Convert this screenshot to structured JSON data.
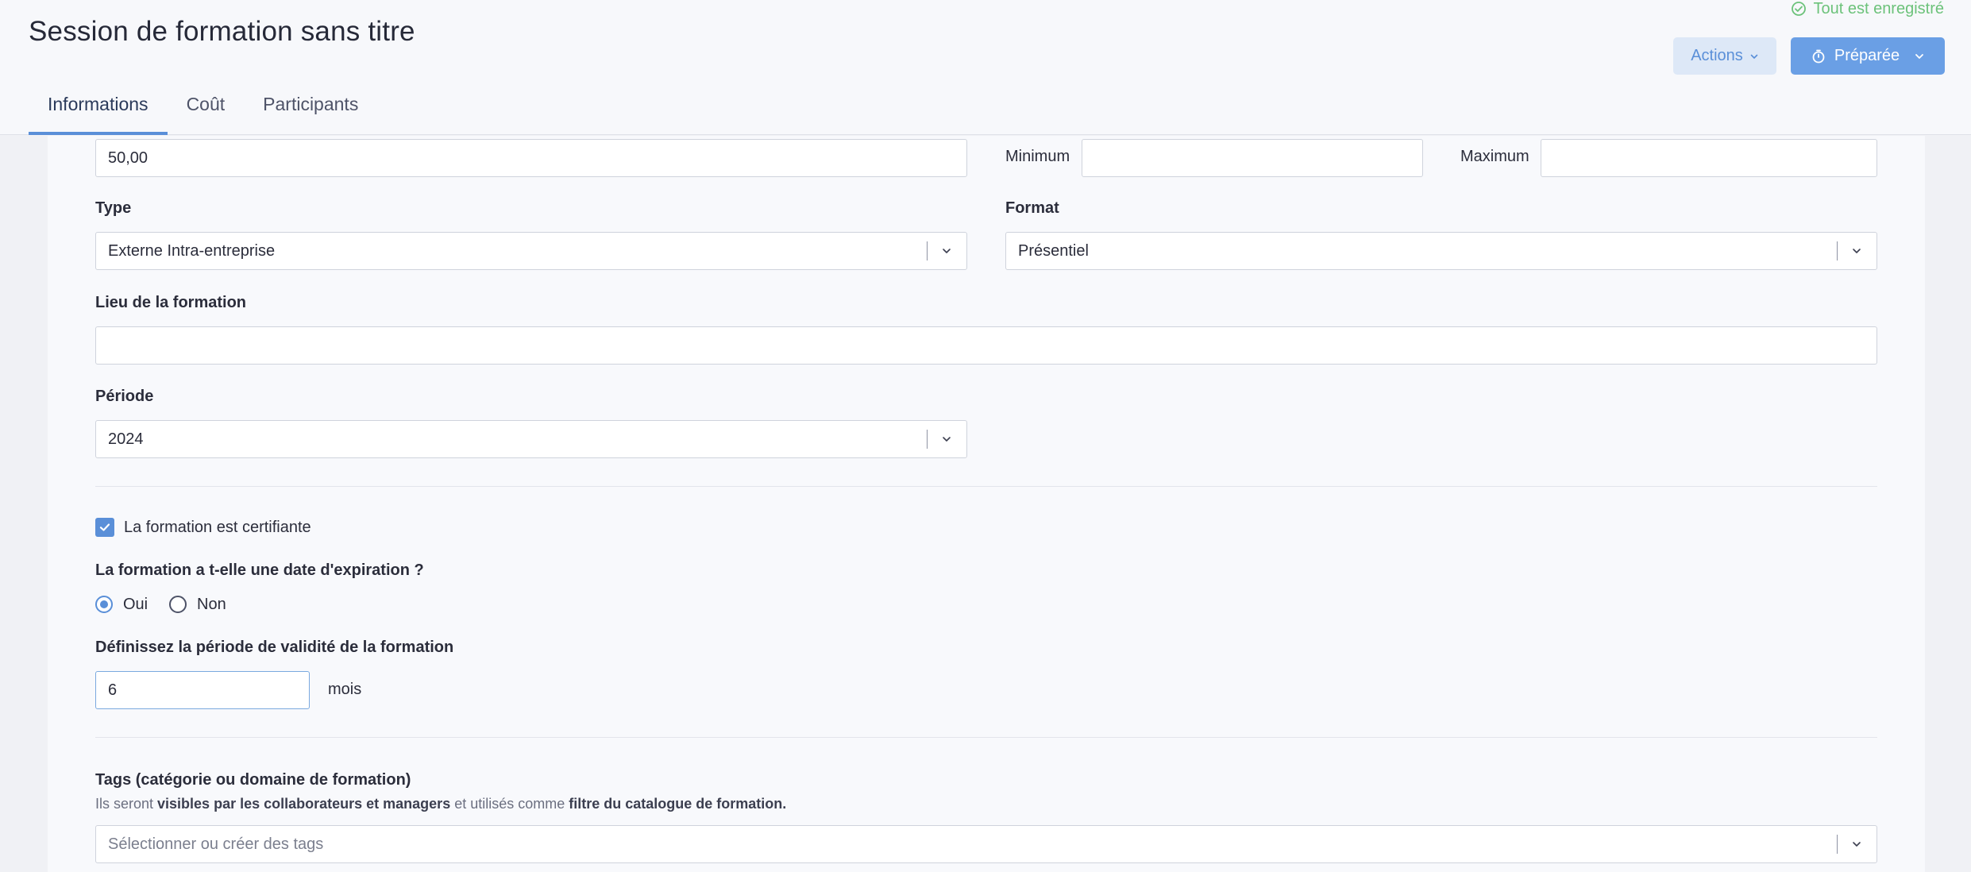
{
  "header": {
    "title": "Session de formation sans titre",
    "saved_status": "Tout est enregistré",
    "actions_label": "Actions",
    "status_label": "Préparée"
  },
  "tabs": [
    {
      "label": "Informations",
      "active": true
    },
    {
      "label": "Coût",
      "active": false
    },
    {
      "label": "Participants",
      "active": false
    }
  ],
  "form": {
    "duration_value": "50,00",
    "minimum_label": "Minimum",
    "minimum_value": "",
    "maximum_label": "Maximum",
    "maximum_value": "",
    "type_label": "Type",
    "type_value": "Externe Intra-entreprise",
    "format_label": "Format",
    "format_value": "Présentiel",
    "location_label": "Lieu de la formation",
    "location_value": "",
    "period_label": "Période",
    "period_value": "2024",
    "certifying_label": "La formation est certifiante",
    "certifying_checked": true,
    "expiration_question": "La formation a t-elle une date d'expiration ?",
    "expiration_yes": "Oui",
    "expiration_no": "Non",
    "expiration_selected": "Oui",
    "validity_label": "Définissez la période de validité de la formation",
    "validity_value": "6",
    "validity_unit": "mois",
    "tags_label": "Tags (catégorie ou domaine de formation)",
    "tags_hint_1": "Ils seront ",
    "tags_hint_2": "visibles par les collaborateurs et managers",
    "tags_hint_3": " et utilisés comme ",
    "tags_hint_4": "filtre du catalogue de formation.",
    "tags_placeholder": "Sélectionner ou créer des tags"
  },
  "colors": {
    "accent": "#5a8fd8",
    "saved_green": "#6cc27a",
    "primary_button": "#6a9fe5"
  }
}
